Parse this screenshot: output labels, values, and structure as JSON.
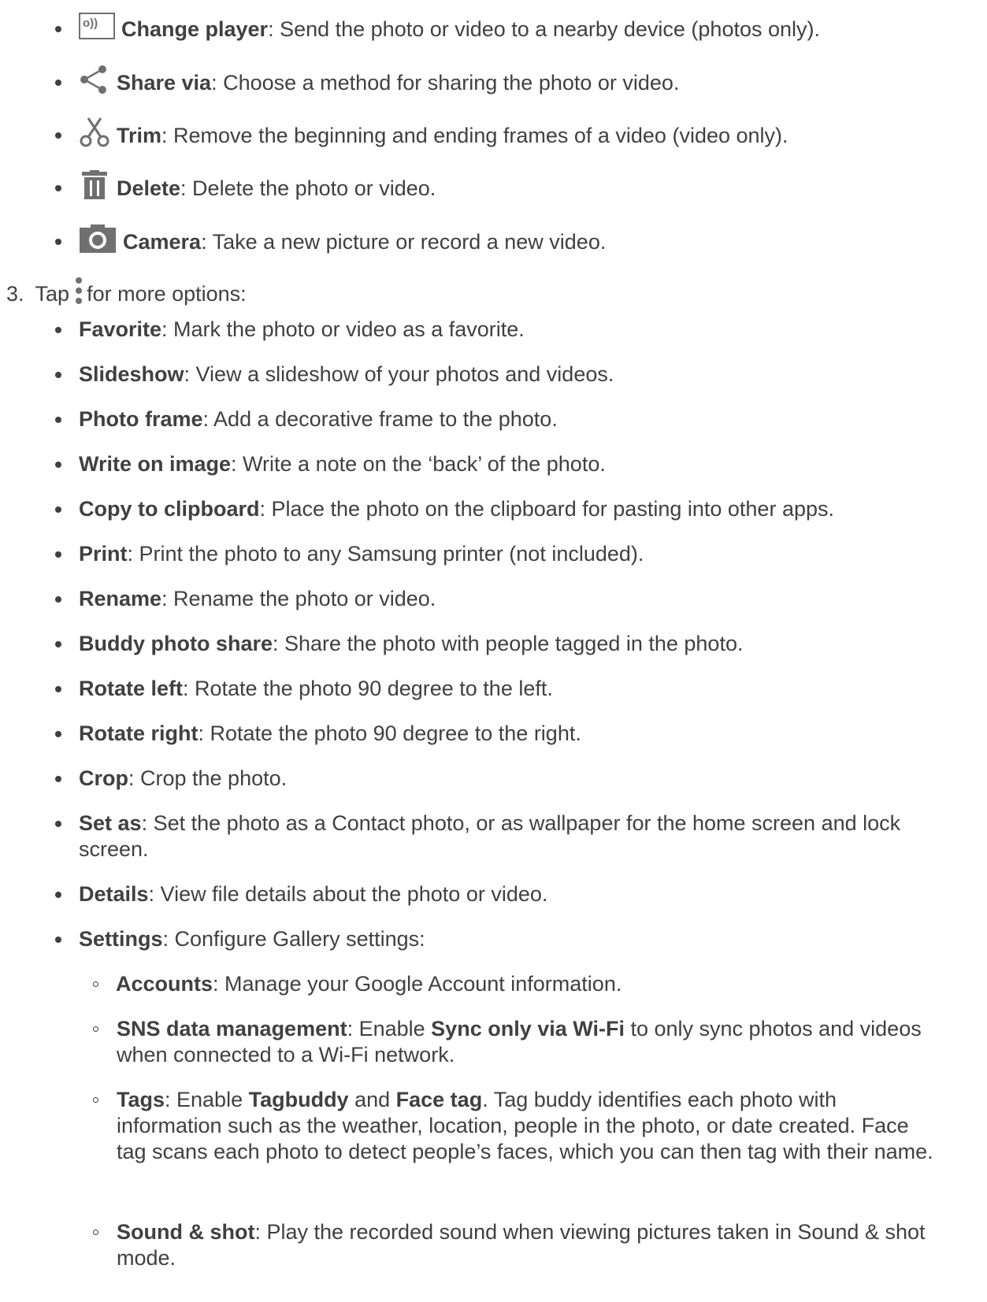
{
  "icon_items": [
    {
      "icon": "cast-icon",
      "term": "Change player",
      "desc": ": Send the photo or video to a nearby device (photos only)."
    },
    {
      "icon": "share-icon",
      "term": "Share via",
      "desc": ": Choose a method for sharing the photo or video."
    },
    {
      "icon": "scissors-icon",
      "term": "Trim",
      "desc": ": Remove the beginning and ending frames of a video (video only)."
    },
    {
      "icon": "trash-icon",
      "term": "Delete",
      "desc": ": Delete the photo or video."
    },
    {
      "icon": "camera-icon",
      "term": "Camera",
      "desc": ": Take a new picture or record a new video."
    }
  ],
  "step3": {
    "number": "3.",
    "before": "Tap",
    "icon": "more-options-icon",
    "after": "for more options:"
  },
  "options": [
    {
      "term": "Favorite",
      "desc": ": Mark the photo or video as a favorite."
    },
    {
      "term": "Slideshow",
      "desc": ": View a slideshow of your photos and videos."
    },
    {
      "term": "Photo frame",
      "desc": ": Add a decorative frame to the photo."
    },
    {
      "term": "Write on image",
      "desc": ": Write a note on the ‘back’ of the photo."
    },
    {
      "term": "Copy to clipboard",
      "desc": ": Place the photo on the clipboard for pasting into other apps."
    },
    {
      "term": "Print",
      "desc": ": Print the photo to any Samsung printer (not included)."
    },
    {
      "term": "Rename",
      "desc": ": Rename the photo or video."
    },
    {
      "term": "Buddy photo share",
      "desc": ": Share the photo with people tagged in the photo."
    },
    {
      "term": "Rotate left",
      "desc": ": Rotate the photo 90 degree to the left."
    },
    {
      "term": "Rotate right",
      "desc": ": Rotate the photo 90 degree to the right."
    },
    {
      "term": "Crop",
      "desc": ": Crop the photo."
    },
    {
      "term": "Set as",
      "desc": ": Set the photo as a Contact photo, or as wallpaper for the home screen and lock screen."
    },
    {
      "term": "Details",
      "desc": ": View file details about the photo or video."
    },
    {
      "term": "Settings",
      "desc": ": Configure Gallery settings:"
    }
  ],
  "settings_items": [
    {
      "term": "Accounts",
      "desc": ": Manage your Google Account information."
    },
    {
      "term": "SNS data management",
      "desc1": ": Enable ",
      "term2": "Sync only via Wi-Fi",
      "desc2": " to only sync photos and videos when connected to a Wi-Fi network."
    },
    {
      "term": "Tags",
      "desc1": ": Enable ",
      "term2": "Tagbuddy",
      "desc2": " and ",
      "term3": "Face tag",
      "desc3": ". Tag buddy identifies each photo with information such as the weather, location, people in the photo, or date created. Face tag scans each photo to detect people’s faces, which you can then tag with their name."
    },
    {
      "term": "Sound & shot",
      "desc": ": Play the recorded sound when viewing pictures taken in Sound & shot mode."
    }
  ]
}
